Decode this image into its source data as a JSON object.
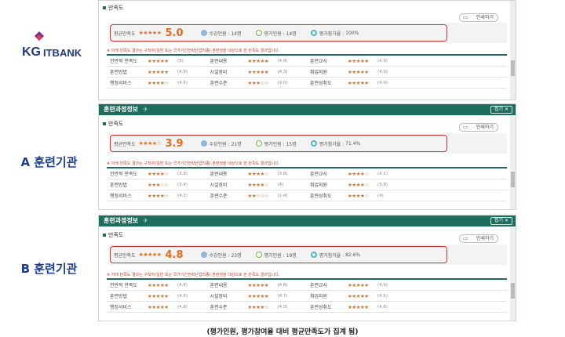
{
  "logo": {
    "kg": "KG",
    "itbank": "ITBANK"
  },
  "labels": {
    "a": "A 훈련기관",
    "b": "B 훈련기관"
  },
  "caption": "(평가인원, 평가참여율 대비 평균만족도가 집계 됨)",
  "colors": {
    "header": "#1d6c5e",
    "star": "#e56b1f",
    "highlight": "#d0312d",
    "label": "#1c3f94"
  },
  "common": {
    "header_title": "훈련과정정보",
    "fold_label": "접기 ✕",
    "section_title": "만족도",
    "print_label": "인쇄하기",
    "avg_label": "평균만족도",
    "trainees_label": "수강인원 :",
    "evaluators_label": "평가인원 :",
    "participation_label": "평가참가율 :",
    "notice": "※ 아래 만족도 결과는 구직자(일반 또는 국가기간전략산업직종) 훈련생을 대상으로 한 만족도 결과입니다."
  },
  "panels": [
    {
      "stars": "★★★★★",
      "score": "5.0",
      "trainees": "14명",
      "evaluators": "14명",
      "participation": "100%",
      "rows": [
        [
          {
            "name": "전반적 만족도",
            "stars": "★★★★★",
            "value": "(5)"
          },
          {
            "name": "훈련내용",
            "stars": "★★★★★",
            "value": "(4.9)"
          },
          {
            "name": "훈련교사",
            "stars": "★★★★★",
            "value": "(4.9)"
          },
          {
            "name": "",
            "stars": "",
            "value": ""
          }
        ],
        [
          {
            "name": "훈련방법",
            "stars": "★★★★★",
            "value": "(4.9)"
          },
          {
            "name": "시설장비",
            "stars": "★★★★★",
            "value": "(4.3)"
          },
          {
            "name": "취업지원",
            "stars": "★★★★★",
            "value": "(4.9)"
          },
          {
            "name": "",
            "stars": "",
            "value": ""
          }
        ],
        [
          {
            "name": "행정서비스",
            "stars": "★★★★☆",
            "value": "(4.5)"
          },
          {
            "name": "훈련수준",
            "stars": "★★★☆☆",
            "value": "(3.5)"
          },
          {
            "name": "훈련성취도",
            "stars": "★★★★★",
            "value": "(4.9)"
          },
          {
            "name": "",
            "stars": "",
            "value": ""
          }
        ]
      ]
    },
    {
      "stars": "★★★★☆",
      "score": "3.9",
      "trainees": "21명",
      "evaluators": "15명",
      "participation": "71.4%",
      "rows": [
        [
          {
            "name": "전반적 만족도",
            "stars": "★★★★☆",
            "value": "(3.9)"
          },
          {
            "name": "훈련내용",
            "stars": "★★★★☆",
            "value": "(3.8)"
          },
          {
            "name": "훈련교사",
            "stars": "★★★★☆",
            "value": "(4.1)"
          },
          {
            "name": "",
            "stars": "",
            "value": ""
          }
        ],
        [
          {
            "name": "훈련방법",
            "stars": "★★★☆☆",
            "value": "(3.4)"
          },
          {
            "name": "시설장비",
            "stars": "★★★★☆",
            "value": "(4)"
          },
          {
            "name": "취업지원",
            "stars": "★★★★☆",
            "value": "(3.8)"
          },
          {
            "name": "",
            "stars": "",
            "value": ""
          }
        ],
        [
          {
            "name": "행정서비스",
            "stars": "★★★★☆",
            "value": "(4.1)"
          },
          {
            "name": "훈련수준",
            "stars": "★★☆☆☆",
            "value": "(2.4)"
          },
          {
            "name": "훈련성취도",
            "stars": "★★★★☆",
            "value": "(4)"
          },
          {
            "name": "",
            "stars": "",
            "value": ""
          }
        ]
      ]
    },
    {
      "stars": "★★★★★",
      "score": "4.8",
      "trainees": "23명",
      "evaluators": "19명",
      "participation": "82.6%",
      "rows": [
        [
          {
            "name": "전반적 만족도",
            "stars": "★★★★★",
            "value": "(4.8)"
          },
          {
            "name": "훈련내용",
            "stars": "★★★★★",
            "value": "(4.8)"
          },
          {
            "name": "훈련교사",
            "stars": "★★★★★",
            "value": "(4.9)"
          },
          {
            "name": "",
            "stars": "",
            "value": ""
          }
        ],
        [
          {
            "name": "훈련방법",
            "stars": "★★★★★",
            "value": "(4.6)"
          },
          {
            "name": "시설장비",
            "stars": "★★★★★",
            "value": "(4.7)"
          },
          {
            "name": "취업지원",
            "stars": "★★★★★",
            "value": "(4.5)"
          },
          {
            "name": "",
            "stars": "",
            "value": ""
          }
        ],
        [
          {
            "name": "행정서비스",
            "stars": "★★★★★",
            "value": "(4.8)"
          },
          {
            "name": "훈련수준",
            "stars": "★★★★☆",
            "value": "(4.3)"
          },
          {
            "name": "훈련성취도",
            "stars": "★★★★★",
            "value": "(4.8)"
          },
          {
            "name": "",
            "stars": "",
            "value": ""
          }
        ]
      ]
    }
  ]
}
